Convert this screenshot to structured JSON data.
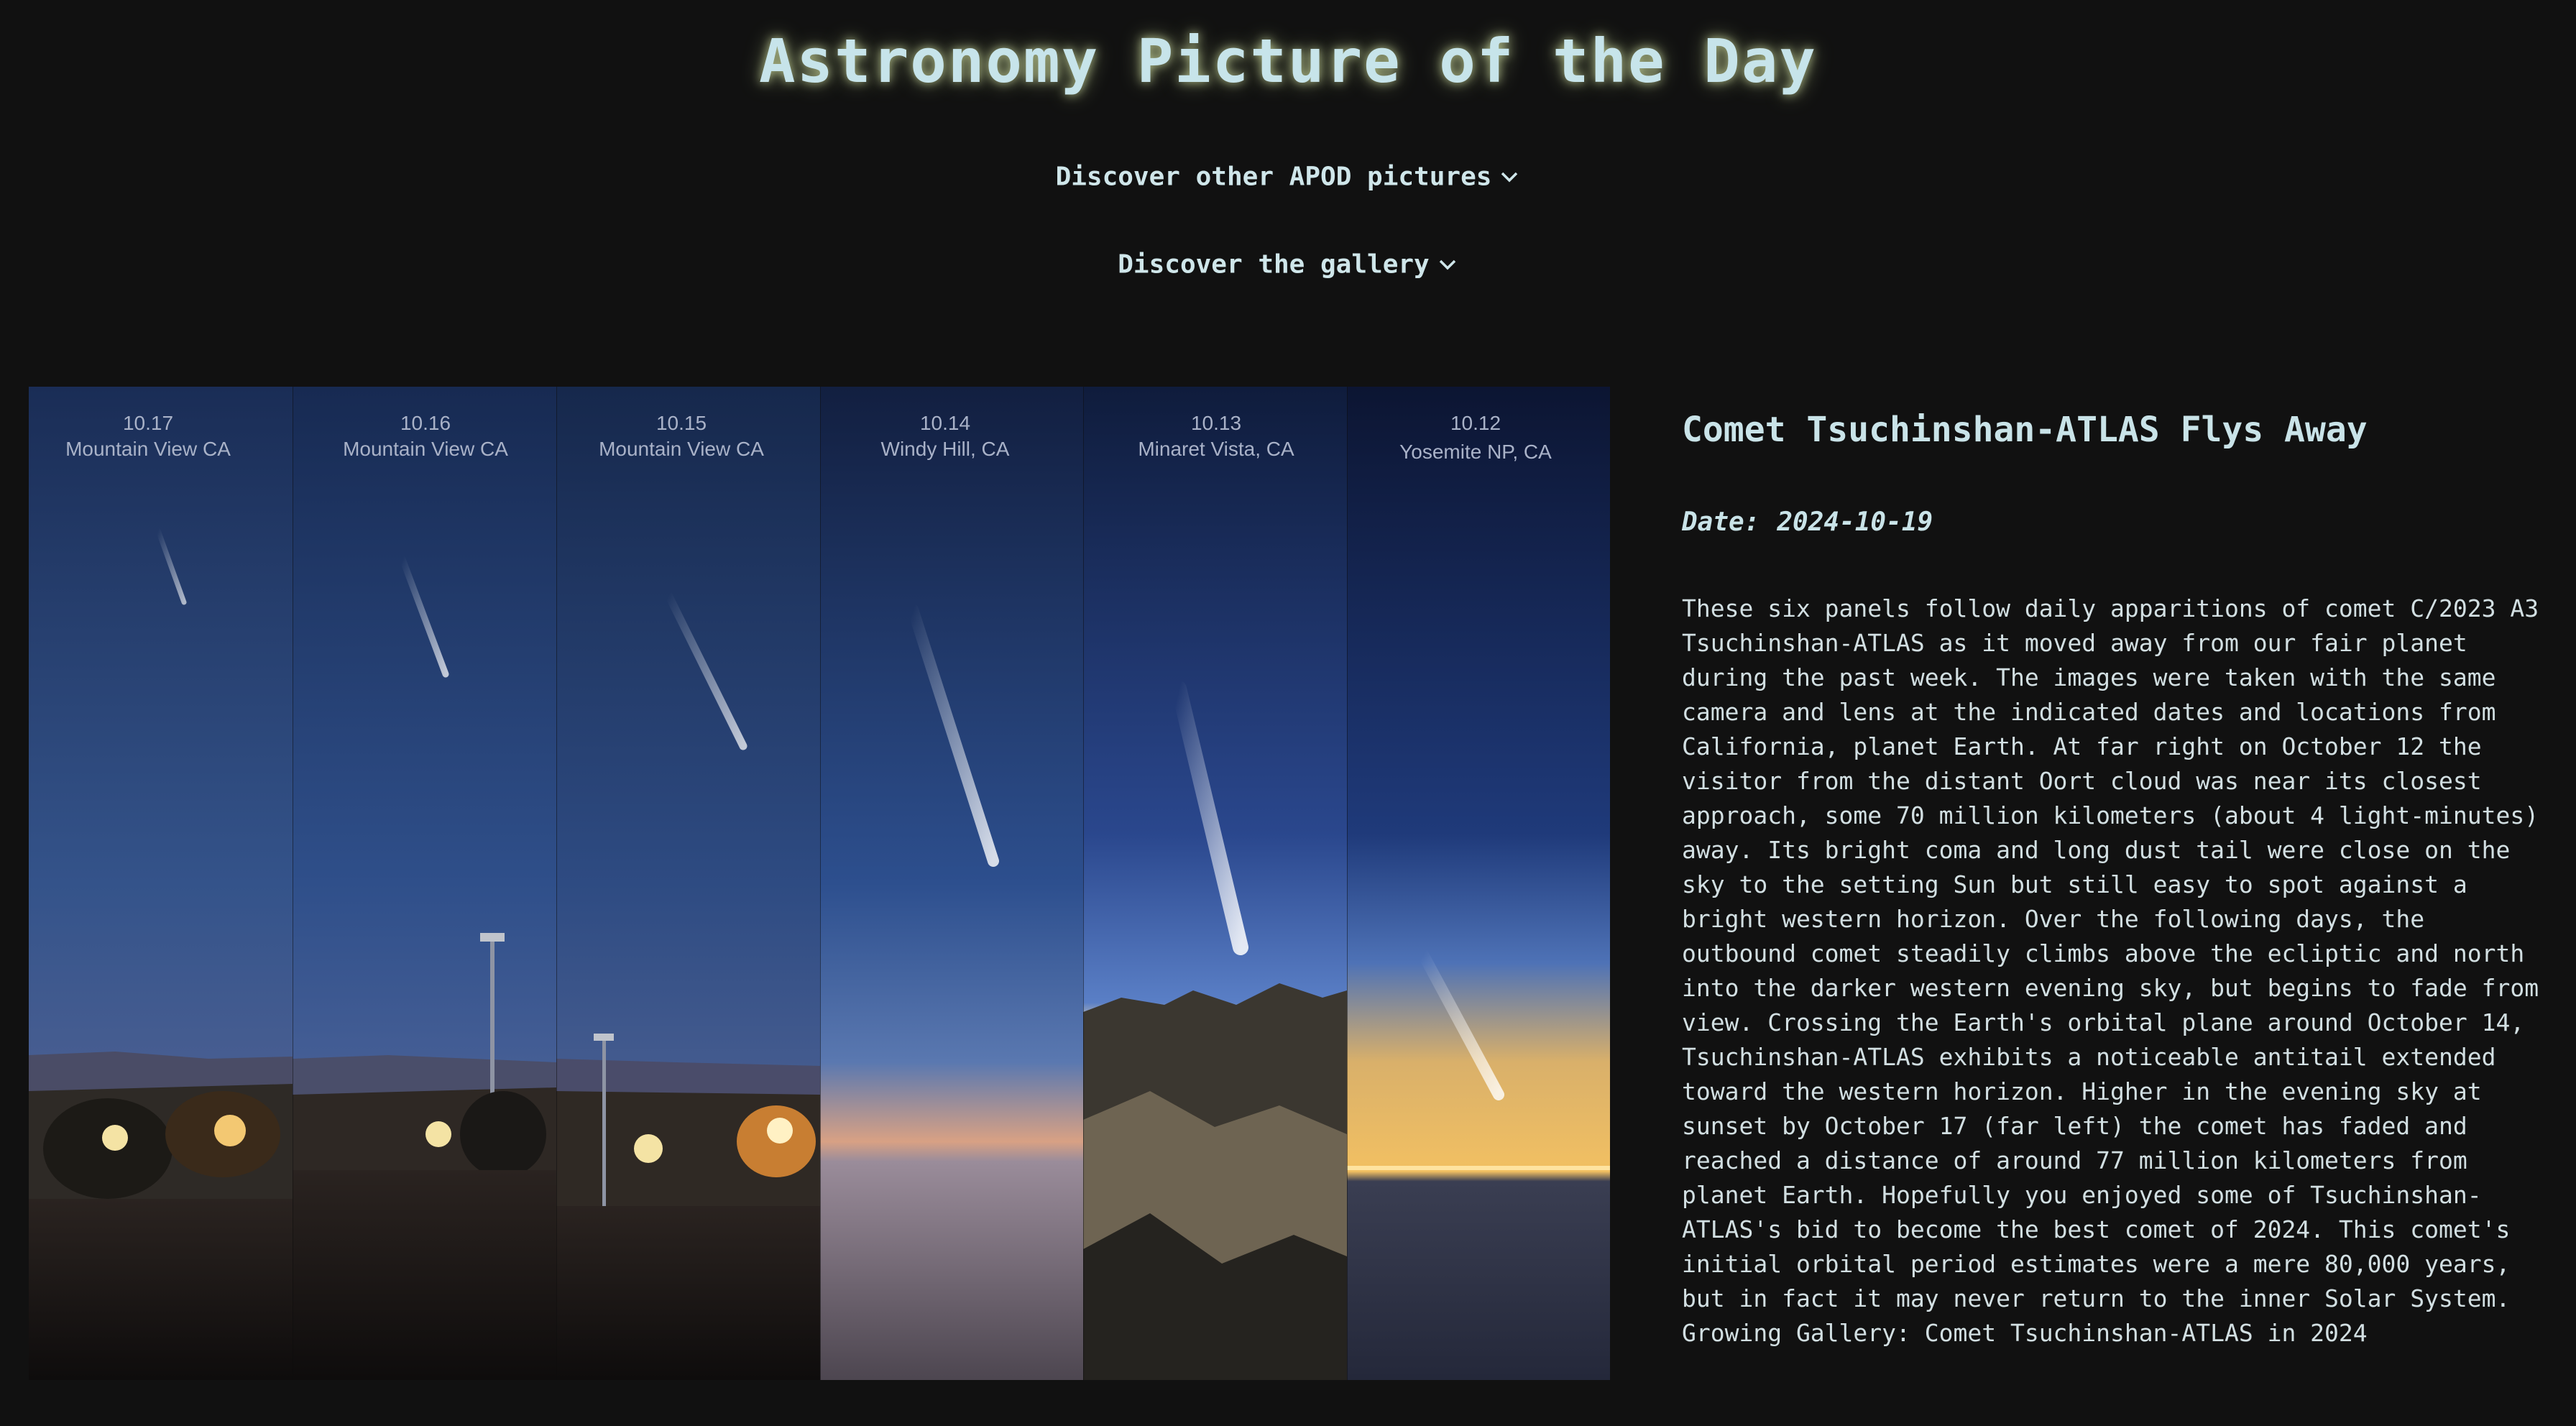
{
  "header": {
    "title": "Astronomy Picture of the Day",
    "discover_apod": "Discover other APOD pictures",
    "discover_gallery": "Discover the gallery"
  },
  "image": {
    "panels": [
      {
        "date": "10.17",
        "location": "Mountain View CA"
      },
      {
        "date": "10.16",
        "location": "Mountain View CA"
      },
      {
        "date": "10.15",
        "location": "Mountain View CA"
      },
      {
        "date": "10.14",
        "location": "Windy Hill, CA"
      },
      {
        "date": "10.13",
        "location": "Minaret Vista, CA"
      },
      {
        "date": "10.12",
        "location": "Yosemite NP, CA"
      }
    ]
  },
  "apod": {
    "title": "Comet Tsuchinshan-ATLAS Flys Away",
    "date_label": "Date:",
    "date": "2024-10-19",
    "explanation": "These six panels follow daily apparitions of comet C/2023 A3 Tsuchinshan-ATLAS as it moved away from our fair planet during the past week. The images were taken with the same camera and lens at the indicated dates and locations from California, planet Earth. At far right on October 12 the visitor from the distant Oort cloud was near its closest approach, some 70 million kilometers (about 4 light-minutes) away. Its bright coma and long dust tail were close on the sky to the setting Sun but still easy to spot against a bright western horizon. Over the following days, the outbound comet steadily climbs above the ecliptic and north into the darker western evening sky, but begins to fade from view. Crossing the Earth's orbital plane around October 14, Tsuchinshan-ATLAS exhibits a noticeable antitail extended toward the western horizon. Higher in the evening sky at sunset by October 17 (far left) the comet has faded and reached a distance of around 77 million kilometers from planet Earth. Hopefully you enjoyed some of Tsuchinshan-ATLAS's bid to become the best comet of 2024. This comet's initial orbital period estimates were a mere 80,000 years, but in fact it may never return to the inner Solar System.",
    "gallery_link": "Growing Gallery: Comet Tsuchinshan-ATLAS in 2024"
  },
  "colors": {
    "background": "#111111",
    "text": "#c9e3e8",
    "title_glow": "#dcebaa"
  }
}
